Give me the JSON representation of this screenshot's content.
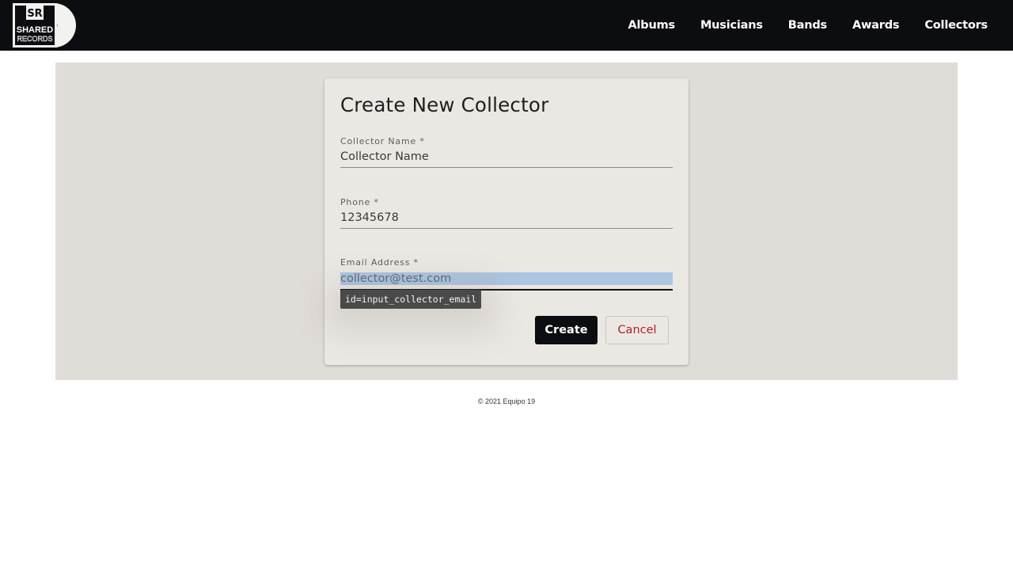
{
  "app": {
    "logo_text_top": "SR",
    "logo_text_main": "SHARED",
    "logo_text_sub": "RECORDS"
  },
  "nav": {
    "items": [
      {
        "label": "Albums"
      },
      {
        "label": "Musicians"
      },
      {
        "label": "Bands"
      },
      {
        "label": "Awards"
      },
      {
        "label": "Collectors"
      }
    ]
  },
  "form": {
    "title": "Create New Collector",
    "name": {
      "label": "Collector Name *",
      "value": "Collector Name"
    },
    "phone": {
      "label": "Phone *",
      "value": "12345678"
    },
    "email": {
      "label": "Email Address *",
      "value": "collector@test.com"
    },
    "tooltip": "id=input_collector_email",
    "create_label": "Create",
    "cancel_label": "Cancel"
  },
  "footer": {
    "text": "© 2021 Equipo 19"
  },
  "colors": {
    "header_bg": "#0c0d11",
    "panel_bg": "#e0dcd7",
    "card_bg": "#ebe8e4",
    "cancel_text": "#b0202a",
    "selection": "#adc5e0"
  }
}
